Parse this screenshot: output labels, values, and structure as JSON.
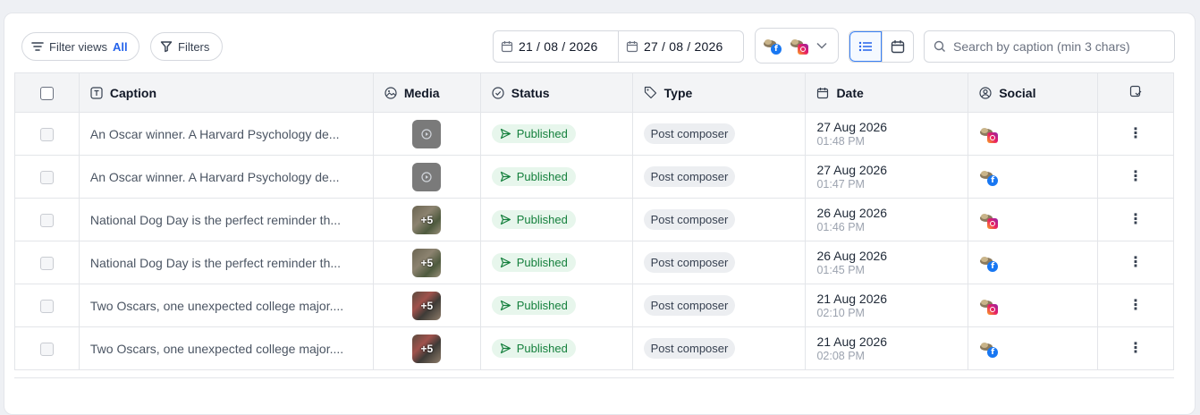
{
  "toolbar": {
    "filter_views_label": "Filter views",
    "filter_views_value": "All",
    "filters_label": "Filters",
    "date_from": "21 / 08 / 2026",
    "date_to": "27 / 08 / 2026",
    "search_placeholder": "Search by caption (min 3 chars)"
  },
  "columns": {
    "caption": "Caption",
    "media": "Media",
    "status": "Status",
    "type": "Type",
    "date": "Date",
    "social": "Social"
  },
  "rows": [
    {
      "caption": "An Oscar winner. A Harvard Psychology de...",
      "media_kind": "video",
      "media_label": "",
      "status": "Published",
      "type": "Post composer",
      "date": "27 Aug 2026",
      "time": "01:48 PM",
      "network": "instagram"
    },
    {
      "caption": "An Oscar winner. A Harvard Psychology de...",
      "media_kind": "video",
      "media_label": "",
      "status": "Published",
      "type": "Post composer",
      "date": "27 Aug 2026",
      "time": "01:47 PM",
      "network": "facebook"
    },
    {
      "caption": "National Dog Day is the perfect reminder th...",
      "media_kind": "image",
      "media_label": "+5",
      "status": "Published",
      "type": "Post composer",
      "date": "26 Aug 2026",
      "time": "01:46 PM",
      "network": "instagram"
    },
    {
      "caption": "National Dog Day is the perfect reminder th...",
      "media_kind": "image",
      "media_label": "+5",
      "status": "Published",
      "type": "Post composer",
      "date": "26 Aug 2026",
      "time": "01:45 PM",
      "network": "facebook"
    },
    {
      "caption": "Two Oscars, one unexpected college major....",
      "media_kind": "image-red",
      "media_label": "+5",
      "status": "Published",
      "type": "Post composer",
      "date": "21 Aug 2026",
      "time": "02:10 PM",
      "network": "instagram"
    },
    {
      "caption": "Two Oscars, one unexpected college major....",
      "media_kind": "image-red",
      "media_label": "+5",
      "status": "Published",
      "type": "Post composer",
      "date": "21 Aug 2026",
      "time": "02:08 PM",
      "network": "facebook"
    }
  ],
  "colors": {
    "accent": "#2563eb",
    "published_bg": "#e7f6ec",
    "published_text": "#15803d",
    "facebook": "#1877f2"
  }
}
